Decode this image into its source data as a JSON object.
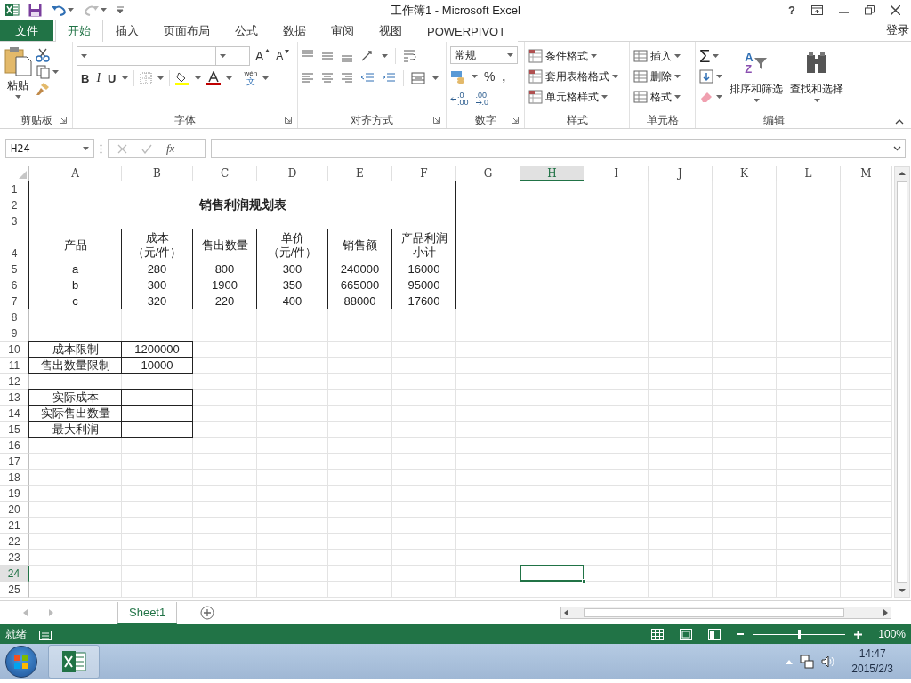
{
  "window": {
    "title": "工作簿1 - Microsoft Excel",
    "help": "?"
  },
  "ribbon": {
    "tabs": [
      {
        "label": "文件",
        "kind": "file",
        "selected": false
      },
      {
        "label": "开始",
        "kind": "tab",
        "selected": true
      },
      {
        "label": "插入",
        "kind": "tab",
        "selected": false
      },
      {
        "label": "页面布局",
        "kind": "tab",
        "selected": false
      },
      {
        "label": "公式",
        "kind": "tab",
        "selected": false
      },
      {
        "label": "数据",
        "kind": "tab",
        "selected": false
      },
      {
        "label": "审阅",
        "kind": "tab",
        "selected": false
      },
      {
        "label": "视图",
        "kind": "tab",
        "selected": false
      },
      {
        "label": "POWERPIVOT",
        "kind": "tab",
        "selected": false
      }
    ],
    "sign_in": "登录",
    "clipboard": {
      "label": "剪贴板",
      "paste": "粘贴"
    },
    "font": {
      "label": "字体",
      "grow": "A",
      "shrink": "A",
      "bold": "B",
      "italic": "I",
      "underline": "U",
      "phonetic": "wén",
      "phonetic_char": "文"
    },
    "alignment": {
      "label": "对齐方式"
    },
    "number": {
      "label": "数字",
      "format": "常规",
      "percent": "%",
      "comma": ",",
      "increase_decimal": [
        ".0",
        ".00"
      ],
      "decrease_decimal": [
        ".00",
        ".0"
      ]
    },
    "styles": {
      "label": "样式",
      "items": [
        "条件格式",
        "套用表格格式",
        "单元格样式"
      ]
    },
    "cells": {
      "label": "单元格",
      "items": [
        "插入",
        "删除",
        "格式"
      ]
    },
    "editing": {
      "label": "编辑",
      "sum": "Σ",
      "sort_letters": [
        "A",
        "Z"
      ],
      "sort": "排序和筛选",
      "find": "查找和选择"
    }
  },
  "formula_bar": {
    "name_box": "H24",
    "function_button": "fx"
  },
  "sheet": {
    "columns": [
      {
        "label": "A",
        "selected": false
      },
      {
        "label": "B",
        "selected": false
      },
      {
        "label": "C",
        "selected": false
      },
      {
        "label": "D",
        "selected": false
      },
      {
        "label": "E",
        "selected": false
      },
      {
        "label": "F",
        "selected": false
      },
      {
        "label": "G",
        "selected": false
      },
      {
        "label": "H",
        "selected": true
      },
      {
        "label": "I",
        "selected": false
      },
      {
        "label": "J",
        "selected": false
      },
      {
        "label": "K",
        "selected": false
      },
      {
        "label": "L",
        "selected": false
      },
      {
        "label": "M",
        "selected": false
      }
    ],
    "title_cell": {
      "text": "销售利润规划表"
    },
    "rows": [
      {
        "number": "1",
        "selected": false,
        "cells": []
      },
      {
        "number": "2",
        "selected": false,
        "cells": []
      },
      {
        "number": "3",
        "selected": false,
        "cells": []
      },
      {
        "number": "4",
        "selected": false,
        "cells": [
          {
            "text": "产品",
            "bordered": true
          },
          {
            "lines": [
              "成本",
              "（元/件）"
            ],
            "bordered": true
          },
          {
            "text": "售出数量",
            "bordered": true
          },
          {
            "lines": [
              "单价",
              "（元/件）"
            ],
            "bordered": true
          },
          {
            "text": "销售额",
            "bordered": true
          },
          {
            "lines": [
              "产品利润",
              "小计"
            ],
            "bordered": true
          }
        ]
      },
      {
        "number": "5",
        "selected": false,
        "cells": [
          {
            "text": "a",
            "bordered": true
          },
          {
            "text": "280",
            "bordered": true
          },
          {
            "text": "800",
            "bordered": true
          },
          {
            "text": "300",
            "bordered": true
          },
          {
            "text": "240000",
            "bordered": true
          },
          {
            "text": "16000",
            "bordered": true
          }
        ]
      },
      {
        "number": "6",
        "selected": false,
        "cells": [
          {
            "text": "b",
            "bordered": true
          },
          {
            "text": "300",
            "bordered": true
          },
          {
            "text": "1900",
            "bordered": true
          },
          {
            "text": "350",
            "bordered": true
          },
          {
            "text": "665000",
            "bordered": true
          },
          {
            "text": "95000",
            "bordered": true
          }
        ]
      },
      {
        "number": "7",
        "selected": false,
        "cells": [
          {
            "text": "c",
            "bordered": true
          },
          {
            "text": "320",
            "bordered": true
          },
          {
            "text": "220",
            "bordered": true
          },
          {
            "text": "400",
            "bordered": true
          },
          {
            "text": "88000",
            "bordered": true
          },
          {
            "text": "17600",
            "bordered": true
          }
        ]
      },
      {
        "number": "8",
        "selected": false,
        "cells": []
      },
      {
        "number": "9",
        "selected": false,
        "cells": []
      },
      {
        "number": "10",
        "selected": false,
        "cells": [
          {
            "text": "成本限制",
            "bordered": true
          },
          {
            "text": "1200000",
            "bordered": true
          }
        ]
      },
      {
        "number": "11",
        "selected": false,
        "cells": [
          {
            "text": "售出数量限制",
            "bordered": true
          },
          {
            "text": "10000",
            "bordered": true
          }
        ]
      },
      {
        "number": "12",
        "selected": false,
        "cells": []
      },
      {
        "number": "13",
        "selected": false,
        "cells": [
          {
            "text": "实际成本",
            "bordered": true
          },
          {
            "bordered": true
          }
        ]
      },
      {
        "number": "14",
        "selected": false,
        "cells": [
          {
            "text": "实际售出数量",
            "bordered": true
          },
          {
            "bordered": true
          }
        ]
      },
      {
        "number": "15",
        "selected": false,
        "cells": [
          {
            "text": "最大利润",
            "bordered": true
          },
          {
            "bordered": true
          }
        ]
      },
      {
        "number": "16",
        "selected": false,
        "cells": []
      },
      {
        "number": "17",
        "selected": false,
        "cells": []
      },
      {
        "number": "18",
        "selected": false,
        "cells": []
      },
      {
        "number": "19",
        "selected": false,
        "cells": []
      },
      {
        "number": "20",
        "selected": false,
        "cells": []
      },
      {
        "number": "21",
        "selected": false,
        "cells": []
      },
      {
        "number": "22",
        "selected": false,
        "cells": []
      },
      {
        "number": "23",
        "selected": false,
        "cells": []
      },
      {
        "number": "24",
        "selected": true,
        "cells": []
      },
      {
        "number": "25",
        "selected": false,
        "cells": []
      }
    ]
  },
  "sheet_tabs": [
    {
      "label": "Sheet1",
      "selected": true
    }
  ],
  "status_bar": {
    "status": "就绪",
    "zoom": "100%",
    "zoom_slider": {
      "level": 0.5
    }
  },
  "taskbar": {
    "time": "14:47",
    "date": "2015/2/3"
  }
}
